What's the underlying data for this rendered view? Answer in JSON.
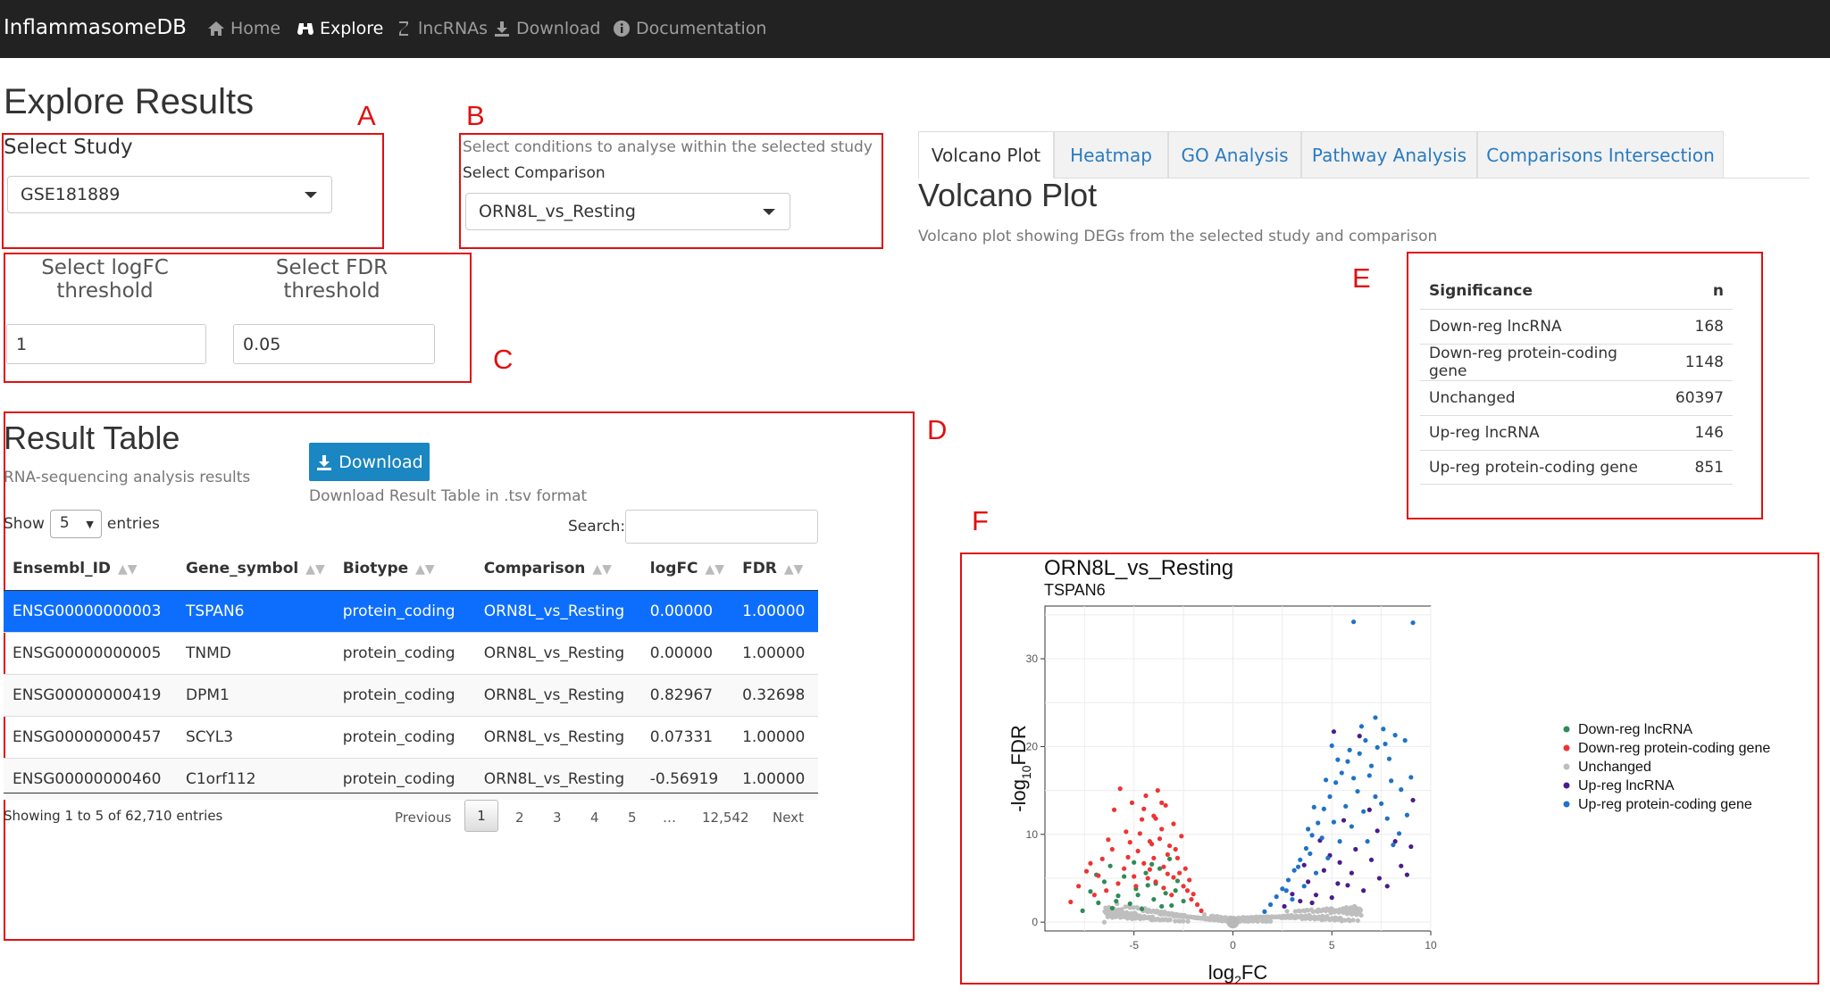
{
  "nav": {
    "brand": "InflammasomeDB",
    "items": [
      {
        "label": "Home",
        "icon": "home-icon"
      },
      {
        "label": "Explore",
        "icon": "binoculars-icon"
      },
      {
        "label": "lncRNAs",
        "icon": "dna-icon"
      },
      {
        "label": "Download",
        "icon": "download-icon"
      },
      {
        "label": "Documentation",
        "icon": "info-icon"
      }
    ]
  },
  "page": {
    "title": "Explore Results"
  },
  "annotations": {
    "a": "A",
    "b": "B",
    "c": "C",
    "d": "D",
    "e": "E",
    "f": "F"
  },
  "study": {
    "label": "Select Study",
    "value": "GSE181889"
  },
  "comparison": {
    "hint": "Select conditions to analyse within the selected study",
    "label": "Select Comparison",
    "value": "ORN8L_vs_Resting"
  },
  "thresholds": {
    "logfc_label_1": "Select logFC",
    "logfc_label_2": "threshold",
    "logfc_value": "1",
    "fdr_label_1": "Select FDR",
    "fdr_label_2": "threshold",
    "fdr_value": "0.05"
  },
  "result_table": {
    "title": "Result Table",
    "subtitle": "RNA-sequencing analysis results",
    "download_label": "Download",
    "download_hint": "Download Result Table in .tsv format",
    "show_label": "Show",
    "entries_value": "5",
    "entries_label": "entries",
    "search_label": "Search:",
    "columns": [
      "Ensembl_ID",
      "Gene_symbol",
      "Biotype",
      "Comparison",
      "logFC",
      "FDR"
    ],
    "rows": [
      [
        "ENSG00000000003",
        "TSPAN6",
        "protein_coding",
        "ORN8L_vs_Resting",
        "0.00000",
        "1.00000"
      ],
      [
        "ENSG00000000005",
        "TNMD",
        "protein_coding",
        "ORN8L_vs_Resting",
        "0.00000",
        "1.00000"
      ],
      [
        "ENSG00000000419",
        "DPM1",
        "protein_coding",
        "ORN8L_vs_Resting",
        "0.82967",
        "0.32698"
      ],
      [
        "ENSG00000000457",
        "SCYL3",
        "protein_coding",
        "ORN8L_vs_Resting",
        "0.07331",
        "1.00000"
      ],
      [
        "ENSG00000000460",
        "C1orf112",
        "protein_coding",
        "ORN8L_vs_Resting",
        "-0.56919",
        "1.00000"
      ]
    ],
    "info": "Showing 1 to 5 of 62,710 entries",
    "pagination": {
      "previous": "Previous",
      "pages": [
        "1",
        "2",
        "3",
        "4",
        "5",
        "…",
        "12,542"
      ],
      "next": "Next",
      "current": "1"
    }
  },
  "tabs": [
    "Volcano Plot",
    "Heatmap",
    "GO Analysis",
    "Pathway Analysis",
    "Comparisons Intersection"
  ],
  "active_tab": "Volcano Plot",
  "volcano": {
    "title": "Volcano Plot",
    "description": "Volcano plot showing DEGs from the selected study and comparison"
  },
  "significance_table": {
    "columns": [
      "Significance",
      "n"
    ],
    "rows": [
      [
        "Down-reg lncRNA",
        "168"
      ],
      [
        "Down-reg protein-coding gene",
        "1148"
      ],
      [
        "Unchanged",
        "60397"
      ],
      [
        "Up-reg lncRNA",
        "146"
      ],
      [
        "Up-reg protein-coding gene",
        "851"
      ]
    ]
  },
  "colors": {
    "down_lncrna": "#2e8b57",
    "down_pc": "#ee3333",
    "unchanged": "#bebebe",
    "up_lncrna": "#4b1b8c",
    "up_pc": "#1e72c8",
    "selected_row": "#0d6efd",
    "annotation_red": "#e01010"
  },
  "chart_data": {
    "type": "scatter",
    "title": "ORN8L_vs_Resting",
    "subtitle": "TSPAN6",
    "xlabel": "log2FC",
    "ylabel": "-log10FDR",
    "xlim": [
      -9.5,
      10
    ],
    "ylim": [
      -1,
      36
    ],
    "xticks": [
      -5,
      0,
      5,
      10
    ],
    "yticks": [
      0,
      10,
      20,
      30
    ],
    "legend_position": "right",
    "highlight": {
      "name": "TSPAN6",
      "x": 0,
      "y": 0
    },
    "series": [
      {
        "name": "Down-reg lncRNA",
        "color_key": "down_lncrna",
        "points": [
          [
            -7.2,
            3.5
          ],
          [
            -6.8,
            2.2
          ],
          [
            -6.5,
            4.6
          ],
          [
            -6.1,
            1.6
          ],
          [
            -5.8,
            3.0
          ],
          [
            -5.5,
            5.2
          ],
          [
            -5.2,
            2.1
          ],
          [
            -4.9,
            3.8
          ],
          [
            -4.6,
            1.5
          ],
          [
            -4.3,
            4.2
          ],
          [
            -4.0,
            2.6
          ],
          [
            -3.7,
            6.1
          ],
          [
            -3.4,
            3.3
          ],
          [
            -3.1,
            1.9
          ],
          [
            -2.8,
            4.7
          ],
          [
            -2.5,
            2.4
          ],
          [
            -6.2,
            6.4
          ],
          [
            -4.4,
            5.6
          ],
          [
            -3.6,
            1.8
          ],
          [
            -5.0,
            6.8
          ],
          [
            -7.6,
            1.3
          ],
          [
            -3.2,
            7.2
          ],
          [
            -4.8,
            3.1
          ],
          [
            -5.9,
            2.4
          ],
          [
            -2.9,
            3.6
          ],
          [
            -4.1,
            6.6
          ],
          [
            -6.9,
            5.4
          ],
          [
            -3.9,
            4.4
          ]
        ]
      },
      {
        "name": "Down-reg protein-coding gene",
        "color_key": "down_pc",
        "points": [
          [
            -8.2,
            2.3
          ],
          [
            -7.8,
            4.1
          ],
          [
            -7.4,
            5.8
          ],
          [
            -7.0,
            3.1
          ],
          [
            -6.6,
            7.2
          ],
          [
            -6.3,
            9.4
          ],
          [
            -6.0,
            12.8
          ],
          [
            -5.7,
            15.2
          ],
          [
            -5.4,
            10.3
          ],
          [
            -5.1,
            13.6
          ],
          [
            -4.8,
            8.1
          ],
          [
            -4.6,
            11.7
          ],
          [
            -4.4,
            14.4
          ],
          [
            -4.2,
            9.2
          ],
          [
            -4.0,
            12.1
          ],
          [
            -3.8,
            15.0
          ],
          [
            -3.6,
            10.6
          ],
          [
            -3.4,
            13.3
          ],
          [
            -3.2,
            8.7
          ],
          [
            -3.0,
            11.2
          ],
          [
            -2.8,
            7.3
          ],
          [
            -2.6,
            9.8
          ],
          [
            -2.4,
            6.1
          ],
          [
            -2.2,
            4.8
          ],
          [
            -2.0,
            3.2
          ],
          [
            -1.8,
            2.0
          ],
          [
            -1.6,
            1.3
          ],
          [
            -5.5,
            6.1
          ],
          [
            -5.0,
            5.2
          ],
          [
            -4.5,
            6.7
          ],
          [
            -4.0,
            7.3
          ],
          [
            -3.5,
            6.3
          ],
          [
            -3.0,
            5.1
          ],
          [
            -2.5,
            4.1
          ],
          [
            -6.8,
            5.3
          ],
          [
            -6.1,
            8.3
          ],
          [
            -5.3,
            7.4
          ],
          [
            -4.7,
            10.1
          ],
          [
            -4.1,
            8.9
          ],
          [
            -3.7,
            9.5
          ],
          [
            -3.3,
            7.7
          ],
          [
            -2.9,
            8.3
          ],
          [
            -2.7,
            5.6
          ],
          [
            -2.3,
            3.6
          ],
          [
            -5.8,
            4.4
          ],
          [
            -4.9,
            4.1
          ],
          [
            -4.3,
            5.0
          ],
          [
            -3.9,
            4.6
          ],
          [
            -3.5,
            3.9
          ],
          [
            -3.1,
            3.1
          ],
          [
            -7.2,
            6.7
          ],
          [
            -6.4,
            3.6
          ],
          [
            -5.2,
            9.1
          ],
          [
            -4.5,
            12.9
          ],
          [
            -3.9,
            11.8
          ],
          [
            -3.6,
            13.6
          ],
          [
            -4.2,
            6.0
          ],
          [
            -3.3,
            5.5
          ],
          [
            -2.1,
            2.6
          ]
        ]
      },
      {
        "name": "Up-reg lncRNA",
        "color_key": "up_lncrna",
        "points": [
          [
            2.6,
            1.8
          ],
          [
            3.0,
            3.2
          ],
          [
            3.4,
            2.4
          ],
          [
            3.8,
            4.6
          ],
          [
            4.2,
            3.1
          ],
          [
            4.6,
            5.9
          ],
          [
            5.0,
            2.8
          ],
          [
            5.4,
            6.8
          ],
          [
            5.8,
            4.2
          ],
          [
            6.2,
            8.3
          ],
          [
            6.6,
            3.6
          ],
          [
            7.0,
            7.1
          ],
          [
            7.4,
            5.0
          ],
          [
            7.8,
            4.1
          ],
          [
            8.2,
            9.2
          ],
          [
            8.8,
            5.4
          ],
          [
            9.0,
            8.6
          ],
          [
            6.4,
            21.2
          ],
          [
            5.1,
            21.7
          ],
          [
            9.1,
            13.9
          ],
          [
            4.4,
            9.3
          ],
          [
            5.6,
            11.6
          ],
          [
            6.9,
            12.8
          ],
          [
            3.6,
            6.5
          ],
          [
            4.9,
            7.6
          ],
          [
            6.0,
            5.6
          ],
          [
            7.3,
            10.4
          ],
          [
            8.5,
            6.4
          ],
          [
            5.3,
            4.4
          ],
          [
            4.0,
            2.2
          ]
        ]
      },
      {
        "name": "Up-reg protein-coding gene",
        "color_key": "up_pc",
        "points": [
          [
            1.6,
            1.2
          ],
          [
            1.9,
            2.0
          ],
          [
            2.2,
            2.9
          ],
          [
            2.5,
            3.8
          ],
          [
            2.8,
            4.8
          ],
          [
            3.1,
            5.9
          ],
          [
            3.4,
            7.1
          ],
          [
            3.7,
            8.4
          ],
          [
            4.0,
            9.9
          ],
          [
            4.3,
            11.3
          ],
          [
            4.6,
            12.9
          ],
          [
            4.9,
            14.3
          ],
          [
            5.2,
            15.9
          ],
          [
            5.5,
            17.0
          ],
          [
            5.8,
            18.3
          ],
          [
            6.1,
            16.4
          ],
          [
            6.4,
            19.2
          ],
          [
            6.7,
            20.7
          ],
          [
            7.0,
            17.8
          ],
          [
            7.3,
            19.9
          ],
          [
            7.6,
            22.0
          ],
          [
            7.9,
            18.6
          ],
          [
            8.2,
            21.3
          ],
          [
            8.5,
            15.1
          ],
          [
            8.8,
            12.2
          ],
          [
            9.0,
            16.5
          ],
          [
            6.1,
            34.2
          ],
          [
            9.1,
            34.1
          ],
          [
            7.2,
            23.3
          ],
          [
            3.0,
            2.6
          ],
          [
            3.6,
            4.1
          ],
          [
            4.2,
            5.6
          ],
          [
            4.8,
            7.3
          ],
          [
            5.4,
            9.2
          ],
          [
            6.0,
            10.9
          ],
          [
            6.6,
            12.6
          ],
          [
            7.2,
            14.3
          ],
          [
            7.8,
            11.8
          ],
          [
            8.4,
            10.1
          ],
          [
            2.7,
            3.6
          ],
          [
            3.3,
            6.3
          ],
          [
            3.9,
            7.8
          ],
          [
            4.5,
            9.6
          ],
          [
            5.1,
            11.4
          ],
          [
            5.7,
            13.2
          ],
          [
            6.3,
            14.9
          ],
          [
            6.9,
            16.7
          ],
          [
            7.5,
            13.5
          ],
          [
            8.1,
            8.8
          ],
          [
            8.7,
            20.7
          ],
          [
            4.1,
            13.1
          ],
          [
            4.7,
            16.2
          ],
          [
            5.3,
            18.5
          ],
          [
            5.9,
            19.6
          ],
          [
            6.5,
            22.3
          ],
          [
            7.7,
            20.3
          ],
          [
            3.8,
            10.6
          ],
          [
            5.0,
            20.1
          ],
          [
            8.0,
            16.1
          ],
          [
            6.8,
            9.2
          ]
        ]
      }
    ]
  }
}
